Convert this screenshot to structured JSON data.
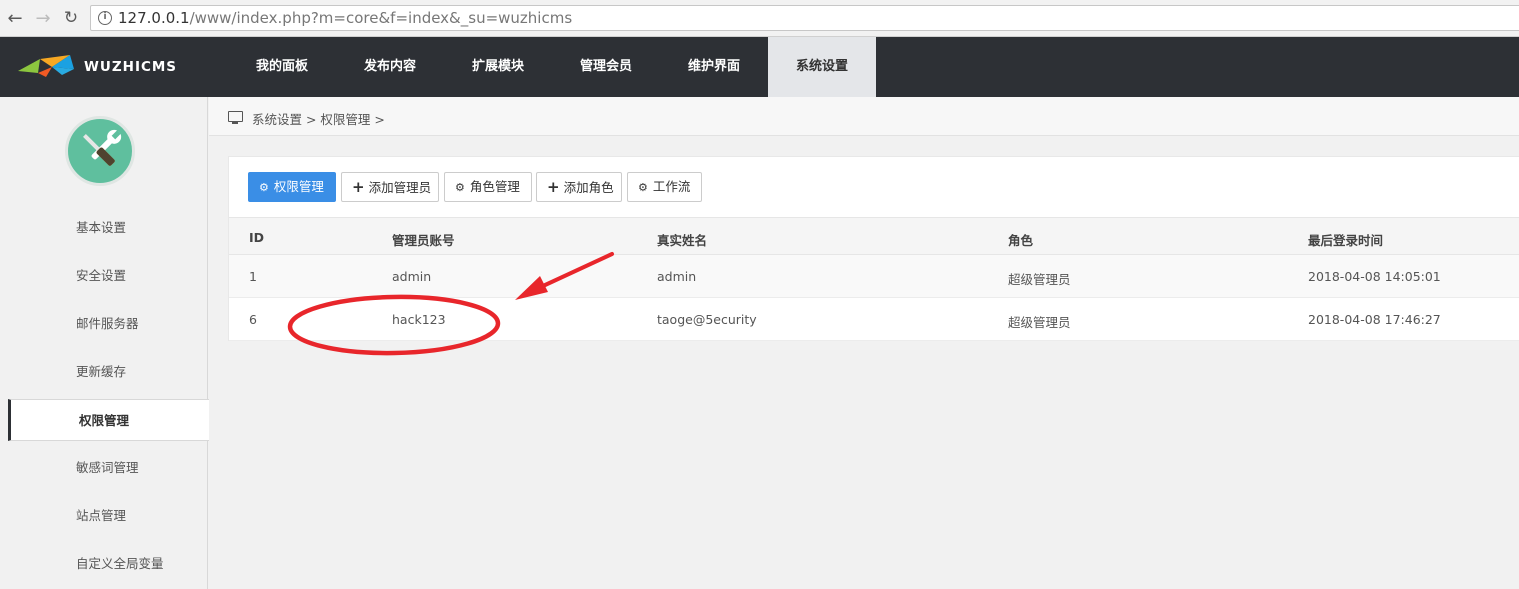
{
  "browser": {
    "url_host": "127.0.0.1",
    "url_rest": "/www/index.php?m=core&f=index&_su=wuzhicms"
  },
  "brand": {
    "name": "WUZHICMS"
  },
  "topnav": {
    "items": [
      {
        "label": "我的面板"
      },
      {
        "label": "发布内容"
      },
      {
        "label": "扩展模块"
      },
      {
        "label": "管理会员"
      },
      {
        "label": "维护界面"
      },
      {
        "label": "系统设置"
      }
    ],
    "active": "系统设置"
  },
  "sidebar": {
    "items": [
      {
        "label": "基本设置"
      },
      {
        "label": "安全设置"
      },
      {
        "label": "邮件服务器"
      },
      {
        "label": "更新缓存"
      },
      {
        "label": "权限管理"
      },
      {
        "label": "敏感词管理"
      },
      {
        "label": "站点管理"
      },
      {
        "label": "自定义全局变量"
      }
    ],
    "active": "权限管理"
  },
  "breadcrumb": {
    "text": "系统设置 > 权限管理 >"
  },
  "toolbar": {
    "buttons": [
      {
        "label": "权限管理",
        "icon": "gears-icon"
      },
      {
        "label": "添加管理员",
        "icon": "plus-icon"
      },
      {
        "label": "角色管理",
        "icon": "gears-icon"
      },
      {
        "label": "添加角色",
        "icon": "plus-icon"
      },
      {
        "label": "工作流",
        "icon": "gears-icon"
      }
    ]
  },
  "table": {
    "headers": [
      "ID",
      "管理员账号",
      "真实姓名",
      "角色",
      "最后登录时间"
    ],
    "rows": [
      [
        "1",
        "admin",
        "admin",
        "超级管理员",
        "2018-04-08 14:05:01"
      ],
      [
        "6",
        "hack123",
        "taoge@5ecurity",
        "超级管理员",
        "2018-04-08 17:46:27"
      ]
    ]
  },
  "colors": {
    "accent": "#3a8ee6",
    "nav_bg": "#2d3035",
    "annotation": "#e8262b"
  }
}
